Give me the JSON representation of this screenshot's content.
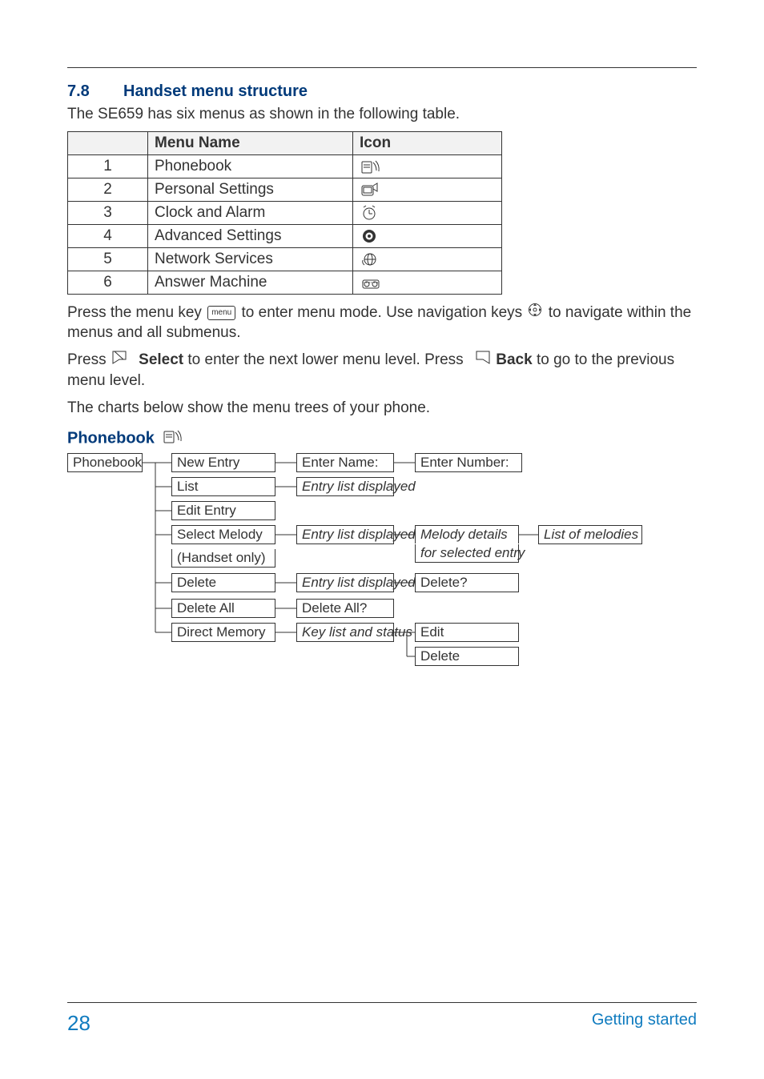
{
  "heading": {
    "number": "7.8",
    "title": "Handset menu structure"
  },
  "intro": "The SE659 has six menus as shown in the following table.",
  "table": {
    "headers": {
      "name": "Menu Name",
      "icon": "Icon"
    },
    "rows": [
      {
        "idx": "1",
        "name": "Phonebook",
        "icon": "phonebook-icon"
      },
      {
        "idx": "2",
        "name": "Personal Settings",
        "icon": "personal-settings-icon"
      },
      {
        "idx": "3",
        "name": "Clock and Alarm",
        "icon": "clock-icon"
      },
      {
        "idx": "4",
        "name": "Advanced Settings",
        "icon": "gear-icon"
      },
      {
        "idx": "5",
        "name": "Network Services",
        "icon": "globe-icon"
      },
      {
        "idx": "6",
        "name": "Answer Machine",
        "icon": "answer-machine-icon"
      }
    ]
  },
  "para1": {
    "prefix": "Press the menu key ",
    "menu_key": "menu",
    "mid": " to enter menu mode. Use navigation keys ",
    "nav_icon": "nav-wheel-icon",
    "suffix": " to navigate within the menus and all submenus."
  },
  "para2": {
    "prefix": "Press ",
    "left_icon": "softkey-left-icon",
    "select_label": "Select",
    "mid": " to enter the next lower menu level. Press ",
    "right_icon": "softkey-right-icon",
    "back_label": "Back",
    "suffix": " to go to the previous menu level."
  },
  "para3": "The charts below show the menu trees of your phone.",
  "tree": {
    "title": "Phonebook",
    "root": "Phonebook",
    "items": {
      "new_entry": "New Entry",
      "enter_name": "Enter Name:",
      "enter_number": "Enter Number:",
      "list": "List",
      "list_leaf": "Entry list displayed",
      "edit_entry": "Edit Entry",
      "select_melody": "Select Melody",
      "handset_only": "(Handset only)",
      "melody_leaf1": "Entry list displayed",
      "melody_leaf2a": "Melody details",
      "melody_leaf2b": "for selected entry",
      "melody_leaf3": "List of melodies",
      "delete": "Delete",
      "delete_leaf": "Entry list displayed",
      "delete_q": "Delete?",
      "delete_all": "Delete All",
      "delete_all_q": "Delete All?",
      "direct_memory": "Direct Memory",
      "keylist_leaf": "Key list and status",
      "edit": "Edit",
      "delete2": "Delete"
    }
  },
  "footer": {
    "page": "28",
    "section": "Getting started"
  }
}
